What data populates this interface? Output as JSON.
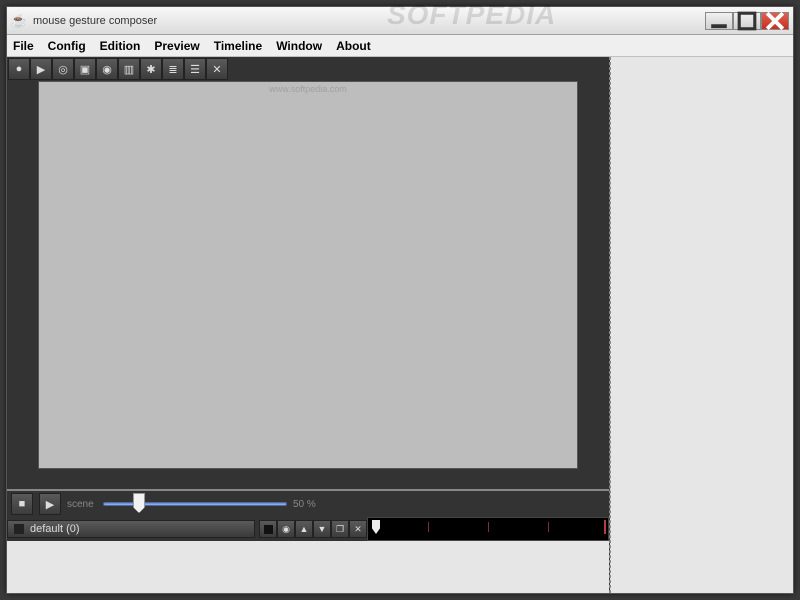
{
  "window": {
    "title": "mouse gesture composer",
    "bg_watermark_left": "SOFTPEDIA",
    "bg_watermark_right": "SOFTPEDIA"
  },
  "menu": {
    "items": [
      "File",
      "Config",
      "Edition",
      "Preview",
      "Timeline",
      "Window",
      "About"
    ]
  },
  "toolbar": {
    "items": [
      {
        "name": "record-icon"
      },
      {
        "name": "play-icon"
      },
      {
        "name": "target-icon"
      },
      {
        "name": "fullscreen-icon"
      },
      {
        "name": "square-target-icon"
      },
      {
        "name": "columns-icon"
      },
      {
        "name": "snowflake-icon"
      },
      {
        "name": "code-icon"
      },
      {
        "name": "list-icon"
      },
      {
        "name": "close-icon"
      }
    ]
  },
  "canvas": {
    "watermark": "www.softpedia.com"
  },
  "slider": {
    "label_left": "scene",
    "label_right": "50 %"
  },
  "layer": {
    "label": "default (0)"
  }
}
